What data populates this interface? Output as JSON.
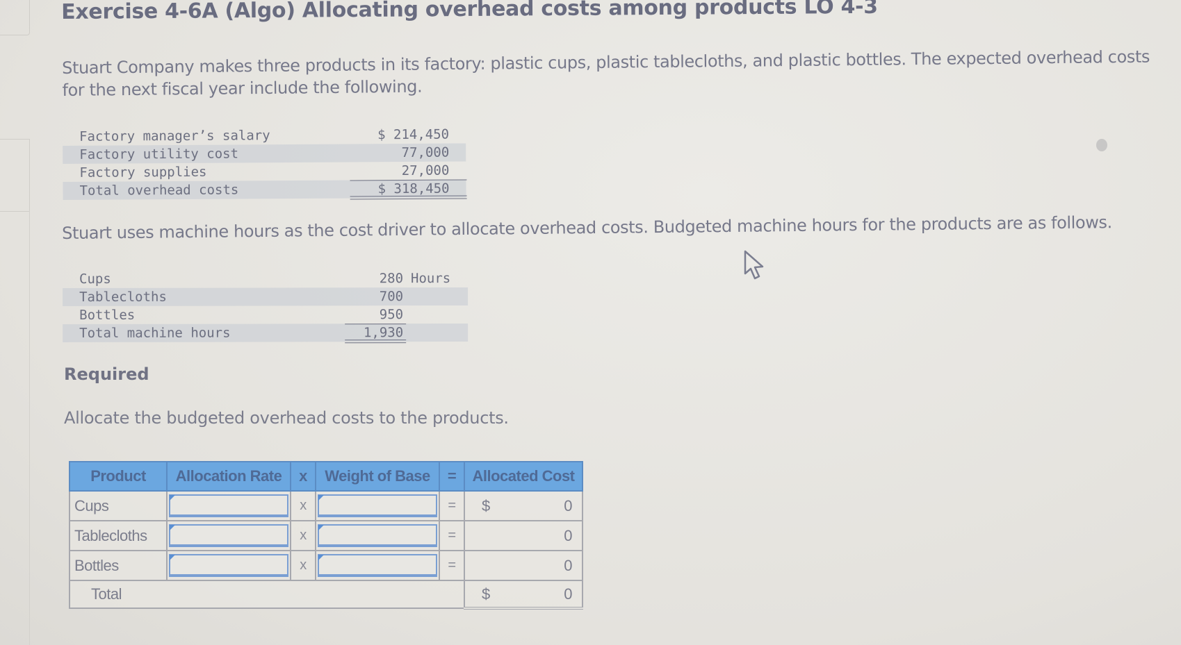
{
  "title": "Exercise 4-6A (Algo) Allocating overhead costs among products LO 4-3",
  "intro_paragraph": "Stuart Company makes three products in its factory: plastic cups, plastic tablecloths, and plastic bottles. The expected overhead costs for the next fiscal year include the following.",
  "overhead_costs": {
    "rows": [
      {
        "label": "Factory manager’s salary",
        "value": "$ 214,450"
      },
      {
        "label": "Factory utility cost",
        "value": "77,000"
      },
      {
        "label": "Factory supplies",
        "value": "27,000"
      },
      {
        "label": "Total overhead costs",
        "value": "$ 318,450"
      }
    ]
  },
  "driver_paragraph": "Stuart uses machine hours as the cost driver to allocate overhead costs. Budgeted machine hours for the products are as follows.",
  "machine_hours": {
    "unit": "Hours",
    "rows": [
      {
        "label": "Cups",
        "value": "280"
      },
      {
        "label": "Tablecloths",
        "value": "700"
      },
      {
        "label": "Bottles",
        "value": "950"
      },
      {
        "label": "Total machine hours",
        "value": "1,930"
      }
    ]
  },
  "required_heading": "Required",
  "instruction": "Allocate the budgeted overhead costs to the products.",
  "allocation_table": {
    "headers": {
      "product": "Product",
      "rate": "Allocation Rate",
      "times": "x",
      "weight": "Weight of Base",
      "equals": "=",
      "cost": "Allocated Cost"
    },
    "rows": [
      {
        "product": "Cups",
        "rate": "",
        "times": "x",
        "weight": "",
        "equals": "=",
        "currency": "$",
        "cost": "0"
      },
      {
        "product": "Tablecloths",
        "rate": "",
        "times": "x",
        "weight": "",
        "equals": "=",
        "currency": "",
        "cost": "0"
      },
      {
        "product": "Bottles",
        "rate": "",
        "times": "x",
        "weight": "",
        "equals": "=",
        "currency": "",
        "cost": "0"
      }
    ],
    "total": {
      "label": "Total",
      "currency": "$",
      "cost": "0"
    }
  },
  "colors": {
    "header_bg": "#6ba7e0",
    "input_border": "#7a9fd3",
    "text": "#6f7181"
  }
}
